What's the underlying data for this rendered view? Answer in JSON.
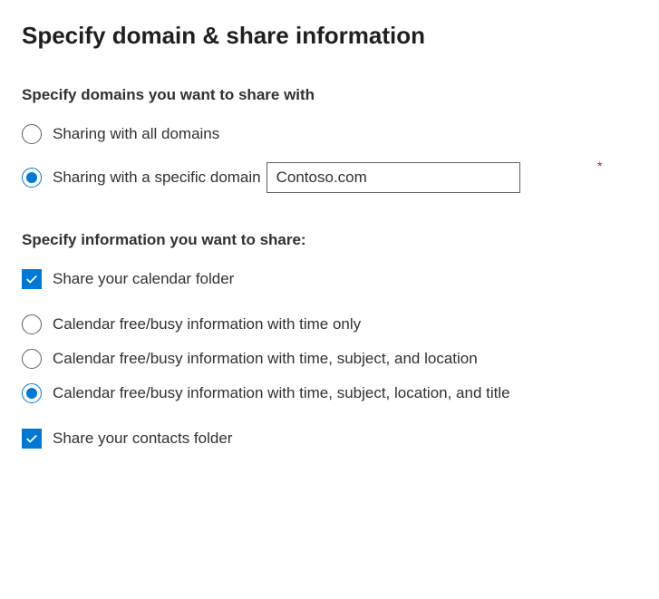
{
  "title": "Specify domain & share information",
  "domainSection": {
    "label": "Specify domains you want to share with",
    "options": {
      "all": "Sharing with all domains",
      "specific": "Sharing with a specific domain"
    },
    "selected": "specific",
    "domainValue": "Contoso.com",
    "requiredMark": "*"
  },
  "infoSection": {
    "label": "Specify information you want to share:",
    "shareCalendar": {
      "label": "Share your calendar folder",
      "checked": true
    },
    "calendarDetail": {
      "options": {
        "timeOnly": "Calendar free/busy information with time only",
        "timeSubjectLocation": "Calendar free/busy information with time, subject, and location",
        "timeSubjectLocationTitle": "Calendar free/busy information with time, subject, location, and title"
      },
      "selected": "timeSubjectLocationTitle"
    },
    "shareContacts": {
      "label": "Share your contacts folder",
      "checked": true
    }
  }
}
